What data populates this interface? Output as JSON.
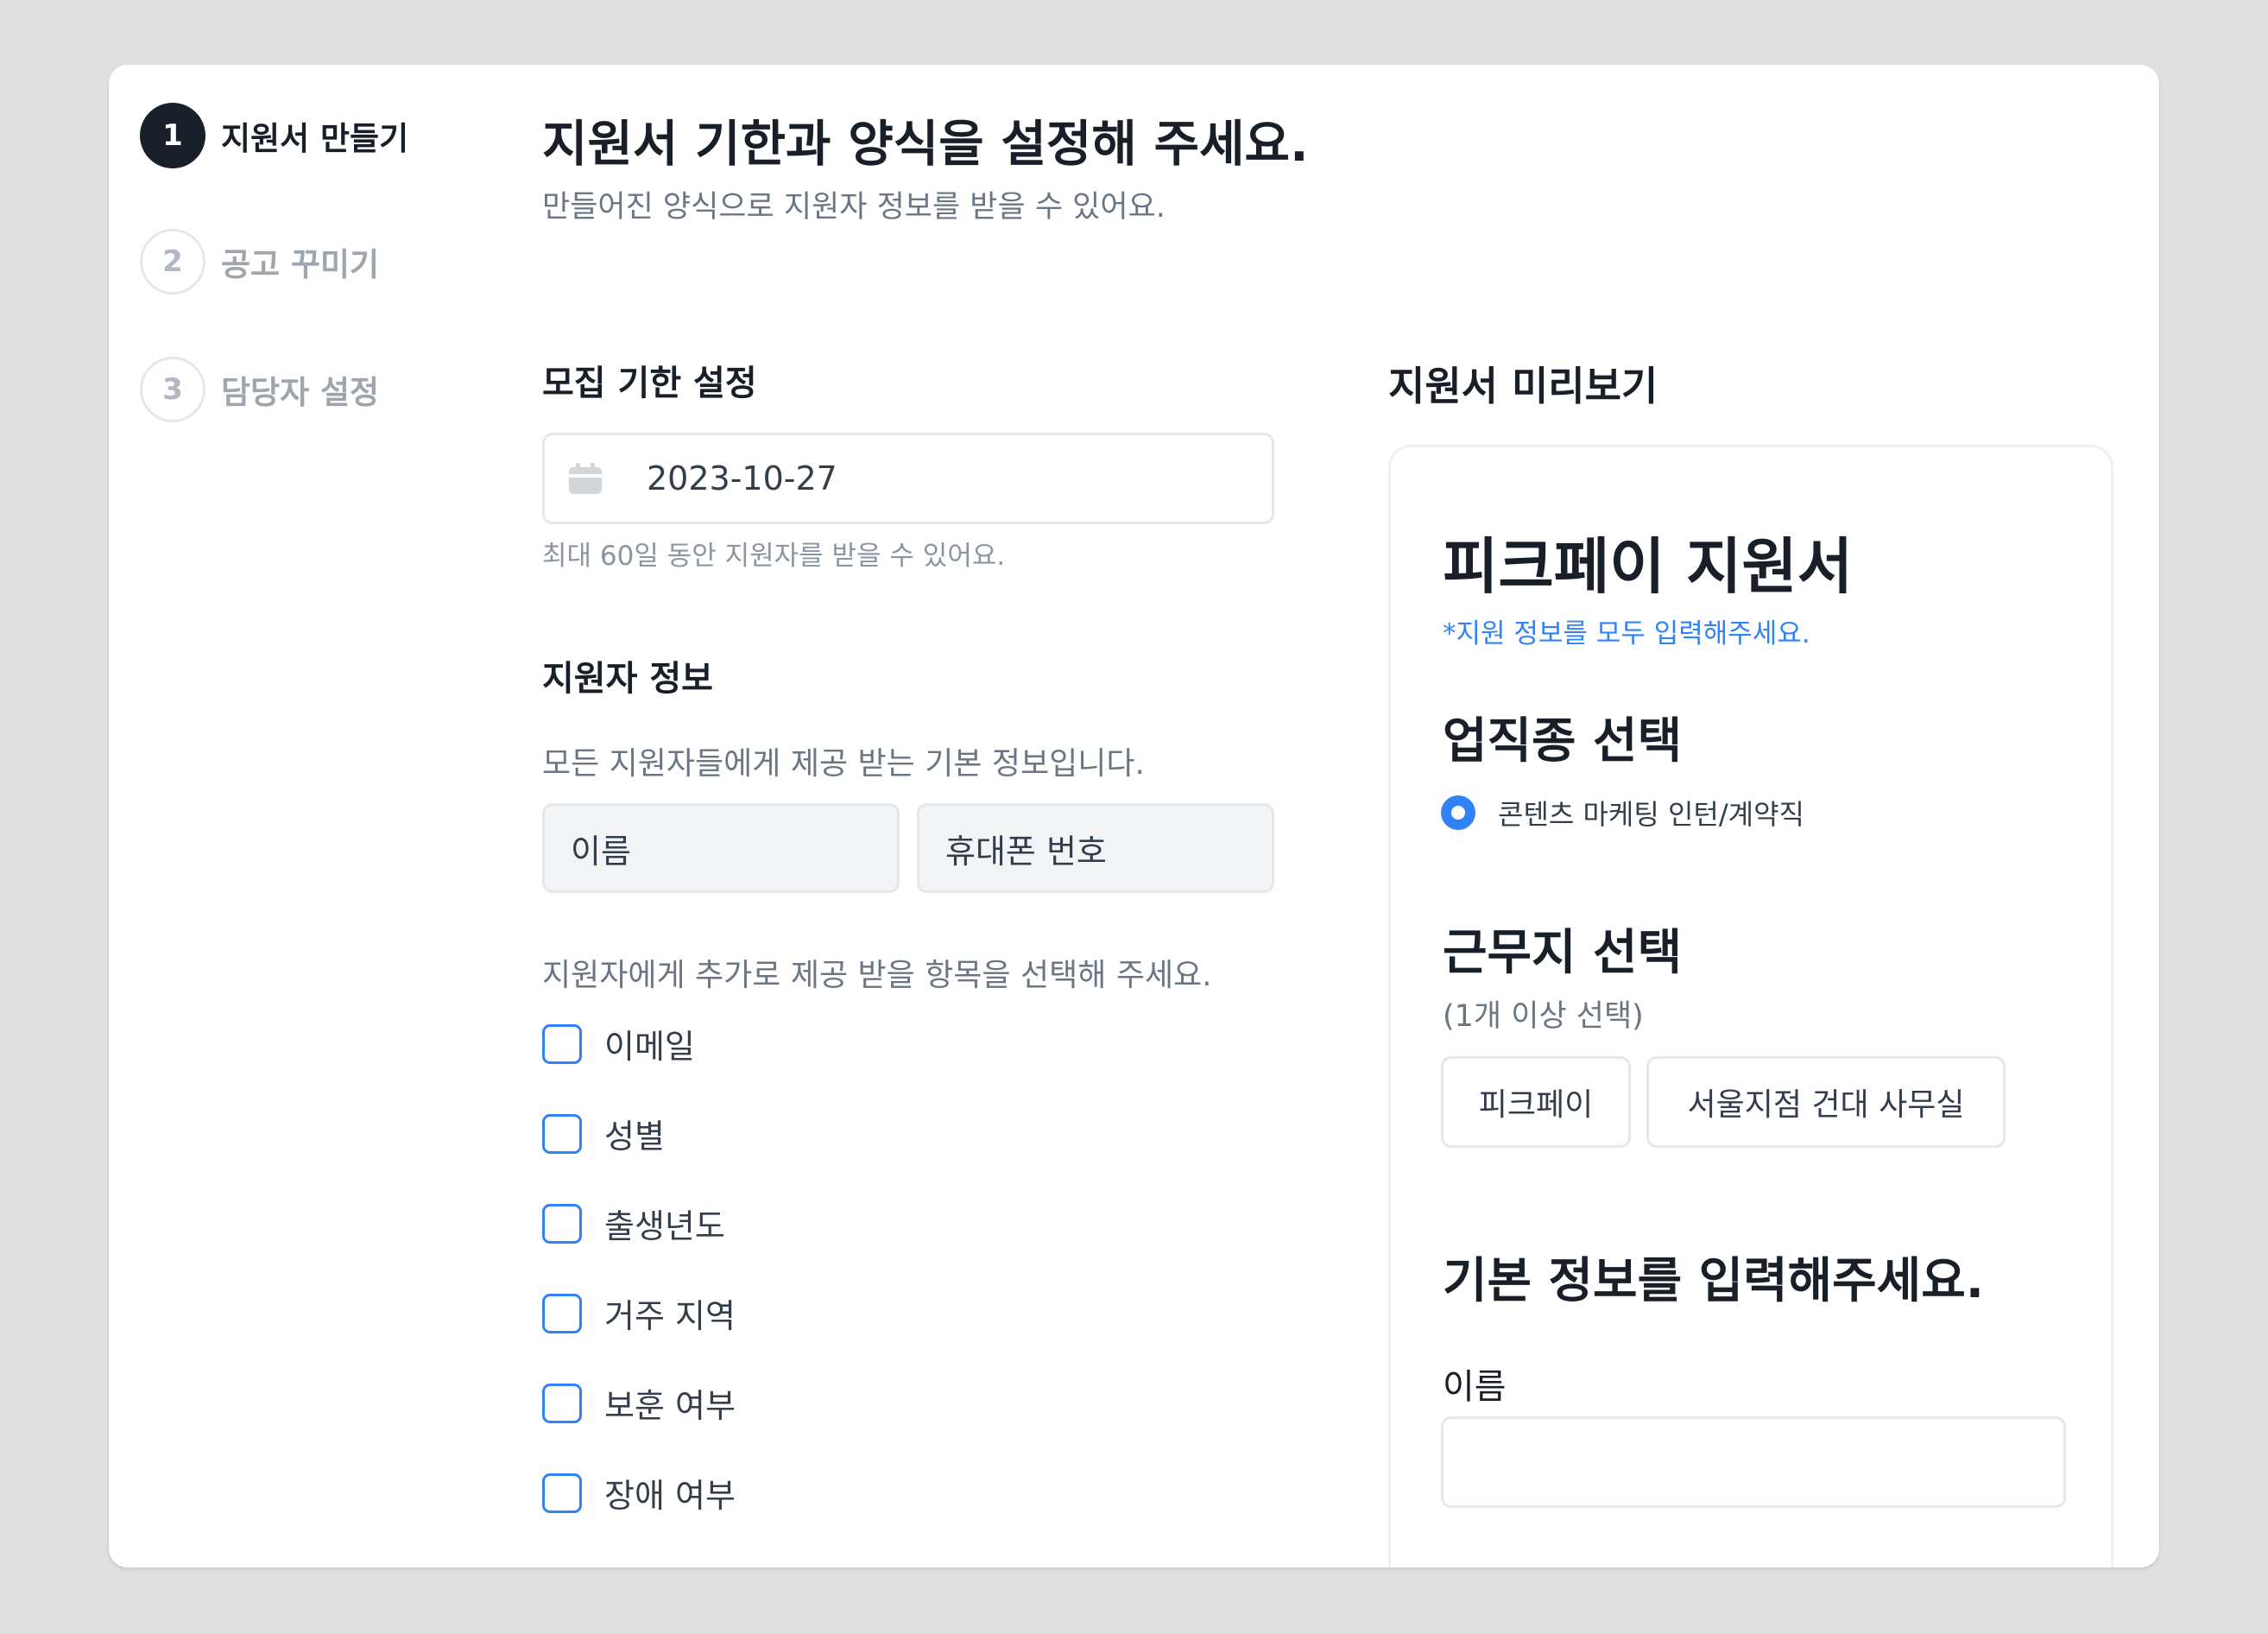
{
  "stepper": [
    {
      "number": "1",
      "label": "지원서 만들기",
      "state": "active"
    },
    {
      "number": "2",
      "label": "공고 꾸미기",
      "state": "inactive"
    },
    {
      "number": "3",
      "label": "담당자 설정",
      "state": "inactive"
    }
  ],
  "header": {
    "title": "지원서 기한과 양식을 설정해 주세요.",
    "subtitle": "만들어진 양식으로 지원자 정보를 받을 수 있어요."
  },
  "deadline": {
    "section_title": "모집 기한 설정",
    "date_value": "2023-10-27",
    "helper": "최대 60일 동안 지원자를 받을 수 있어요."
  },
  "applicant_info": {
    "section_title": "지원자 정보",
    "basic_desc": "모든 지원자들에게 제공 받는 기본 정보입니다.",
    "basic_fields": [
      "이름",
      "휴대폰 번호"
    ],
    "extra_desc": "지원자에게 추가로 제공 받을 항목을 선택해 주세요.",
    "extra_options": [
      "이메일",
      "성별",
      "출생년도",
      "거주 지역",
      "보훈 여부",
      "장애 여부"
    ]
  },
  "preview": {
    "section_title": "지원서 미리보기",
    "app_title": "피크페이 지원서",
    "notice": "*지원 정보를 모두 입력해주세요.",
    "job_heading": "업직종 선택",
    "job_option": "콘텐츠 마케팅 인턴/계약직",
    "location_heading": "근무지 선택",
    "location_sub": "(1개 이상 선택)",
    "location_chips": [
      "피크페이",
      "서울지점 건대 사무실"
    ],
    "basic_heading": "기본 정보를 입력해주세요.",
    "name_label": "이름"
  },
  "colors": {
    "accent": "#3182f6",
    "text_primary": "#191f28",
    "text_secondary": "#6b7684",
    "border": "#e5e8eb"
  }
}
